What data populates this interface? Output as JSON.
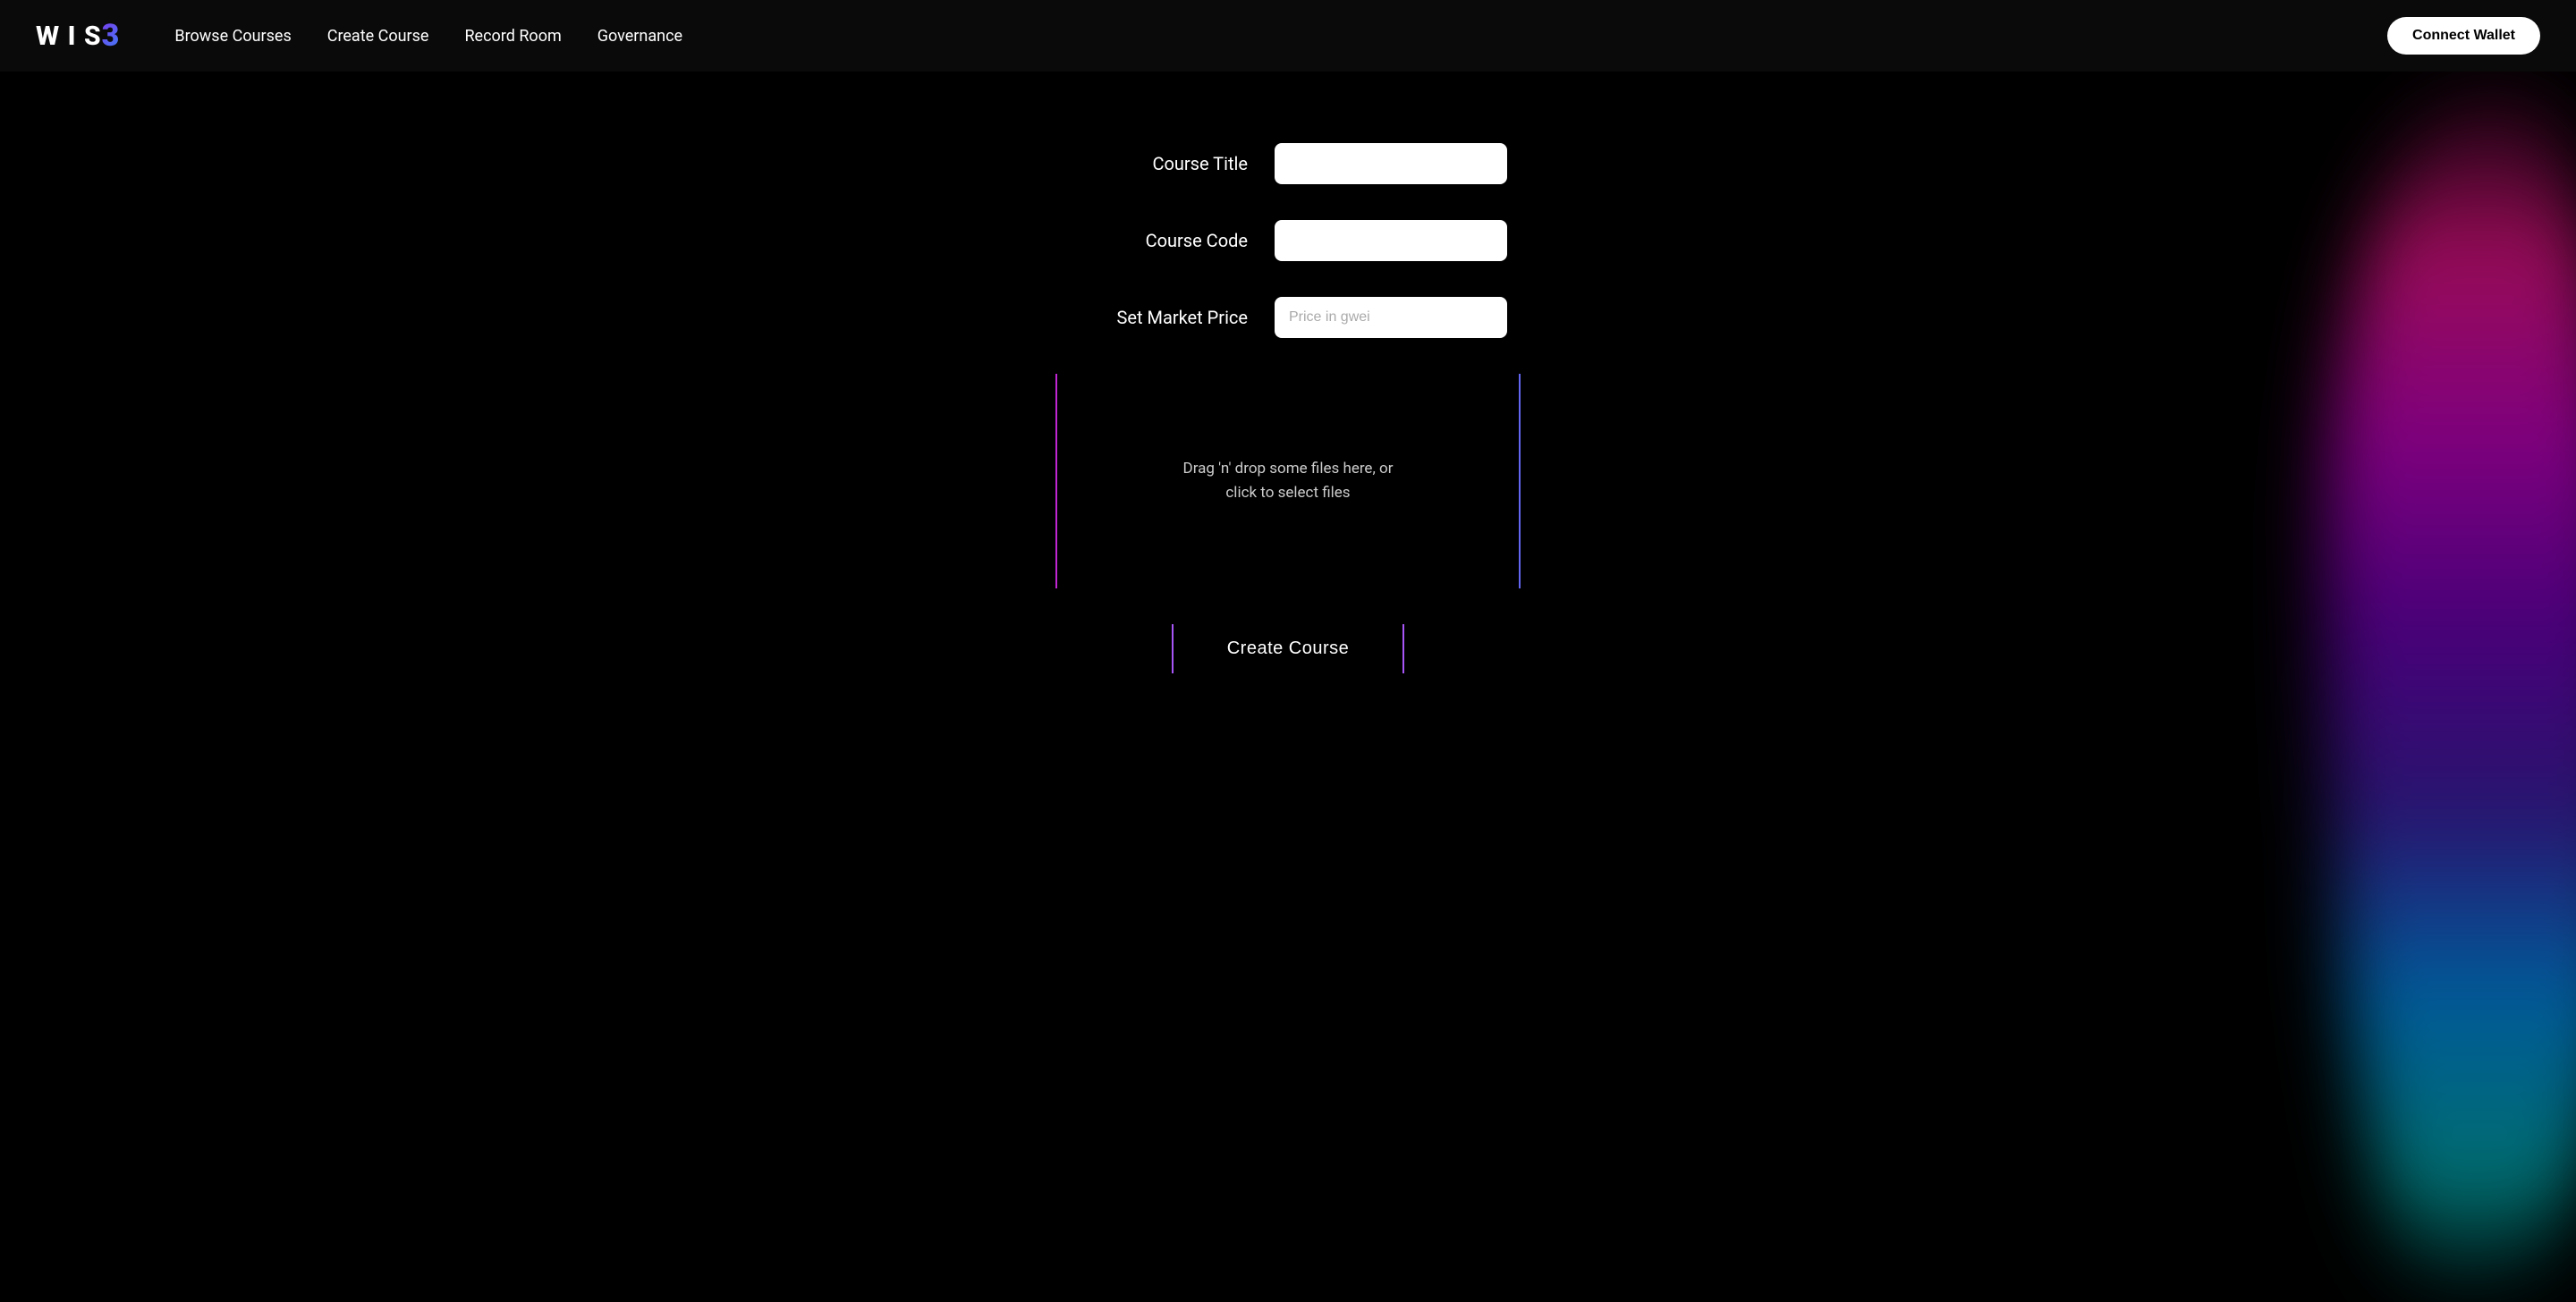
{
  "brand": {
    "logo_text": "W I S",
    "logo_num": "3"
  },
  "navbar": {
    "links": [
      {
        "label": "Browse Courses",
        "id": "browse-courses"
      },
      {
        "label": "Create Course",
        "id": "create-course-nav"
      },
      {
        "label": "Record Room",
        "id": "record-room"
      },
      {
        "label": "Governance",
        "id": "governance"
      }
    ],
    "connect_wallet_label": "Connect Wallet"
  },
  "form": {
    "course_title_label": "Course Title",
    "course_title_placeholder": "",
    "course_code_label": "Course Code",
    "course_code_placeholder": "",
    "set_market_price_label": "Set Market Price",
    "set_market_price_placeholder": "Price in gwei",
    "dropzone_text": "Drag 'n' drop some files here, or\nclick to select files",
    "create_course_button_label": "Create Course"
  },
  "colors": {
    "accent_left": "#c026d3",
    "accent_right": "#6366f1",
    "btn_border": "#a855f7"
  }
}
